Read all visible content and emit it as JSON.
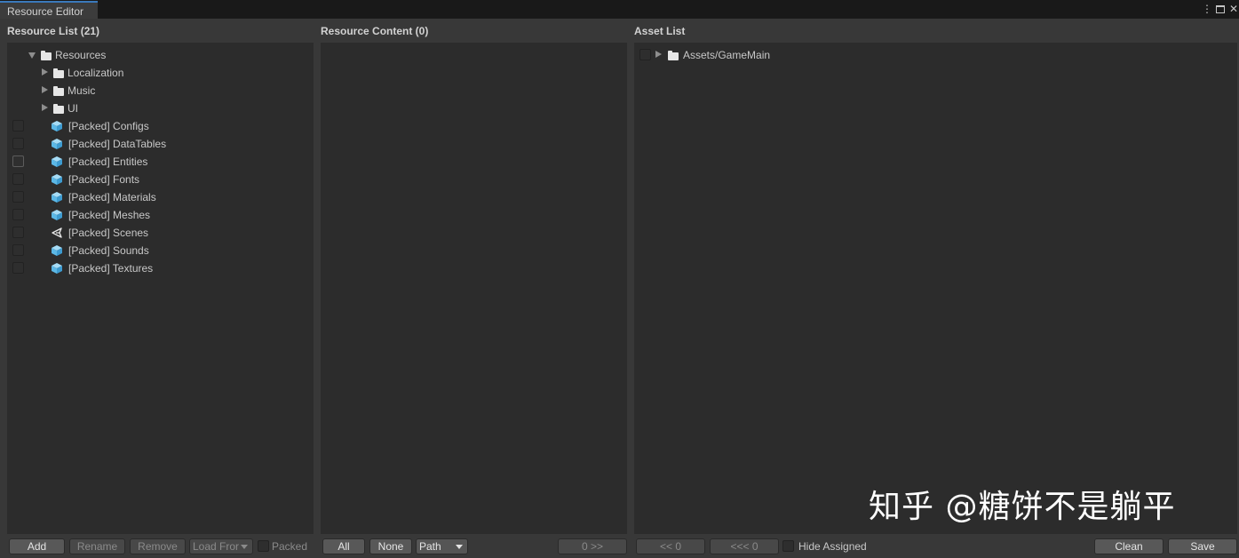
{
  "window": {
    "tab_title": "Resource Editor",
    "controls": {
      "menu": "⋮",
      "close": "✕"
    }
  },
  "headers": {
    "resource_list": "Resource List (21)",
    "resource_content": "Resource Content (0)",
    "asset_list": "Asset List"
  },
  "resource_tree": {
    "root": "Resources",
    "folders": [
      "Localization",
      "Music",
      "UI"
    ],
    "packed": [
      {
        "label": "[Packed] Configs",
        "icon": "cube-icon"
      },
      {
        "label": "[Packed] DataTables",
        "icon": "cube-icon"
      },
      {
        "label": "[Packed] Entities",
        "icon": "cube-icon"
      },
      {
        "label": "[Packed] Fonts",
        "icon": "cube-icon"
      },
      {
        "label": "[Packed] Materials",
        "icon": "cube-icon"
      },
      {
        "label": "[Packed] Meshes",
        "icon": "cube-icon"
      },
      {
        "label": "[Packed] Scenes",
        "icon": "unity-scene-icon"
      },
      {
        "label": "[Packed] Sounds",
        "icon": "cube-icon"
      },
      {
        "label": "[Packed] Textures",
        "icon": "cube-icon"
      }
    ]
  },
  "asset_tree": {
    "root": "Assets/GameMain"
  },
  "toolbar": {
    "add": "Add",
    "rename": "Rename",
    "remove": "Remove",
    "load_from": "Load Fror",
    "packed": "Packed",
    "all": "All",
    "none": "None",
    "path": "Path",
    "move_right": "0 >>",
    "move_left": "<< 0",
    "move_left_all": "<<< 0",
    "hide_assigned": "Hide Assigned",
    "clean": "Clean",
    "save": "Save"
  },
  "watermark": "知乎 @糖饼不是躺平",
  "colors": {
    "accent": "#3a79bb",
    "cube": "#7ccbf0",
    "panel": "#2c2c2c",
    "background": "#383838"
  }
}
